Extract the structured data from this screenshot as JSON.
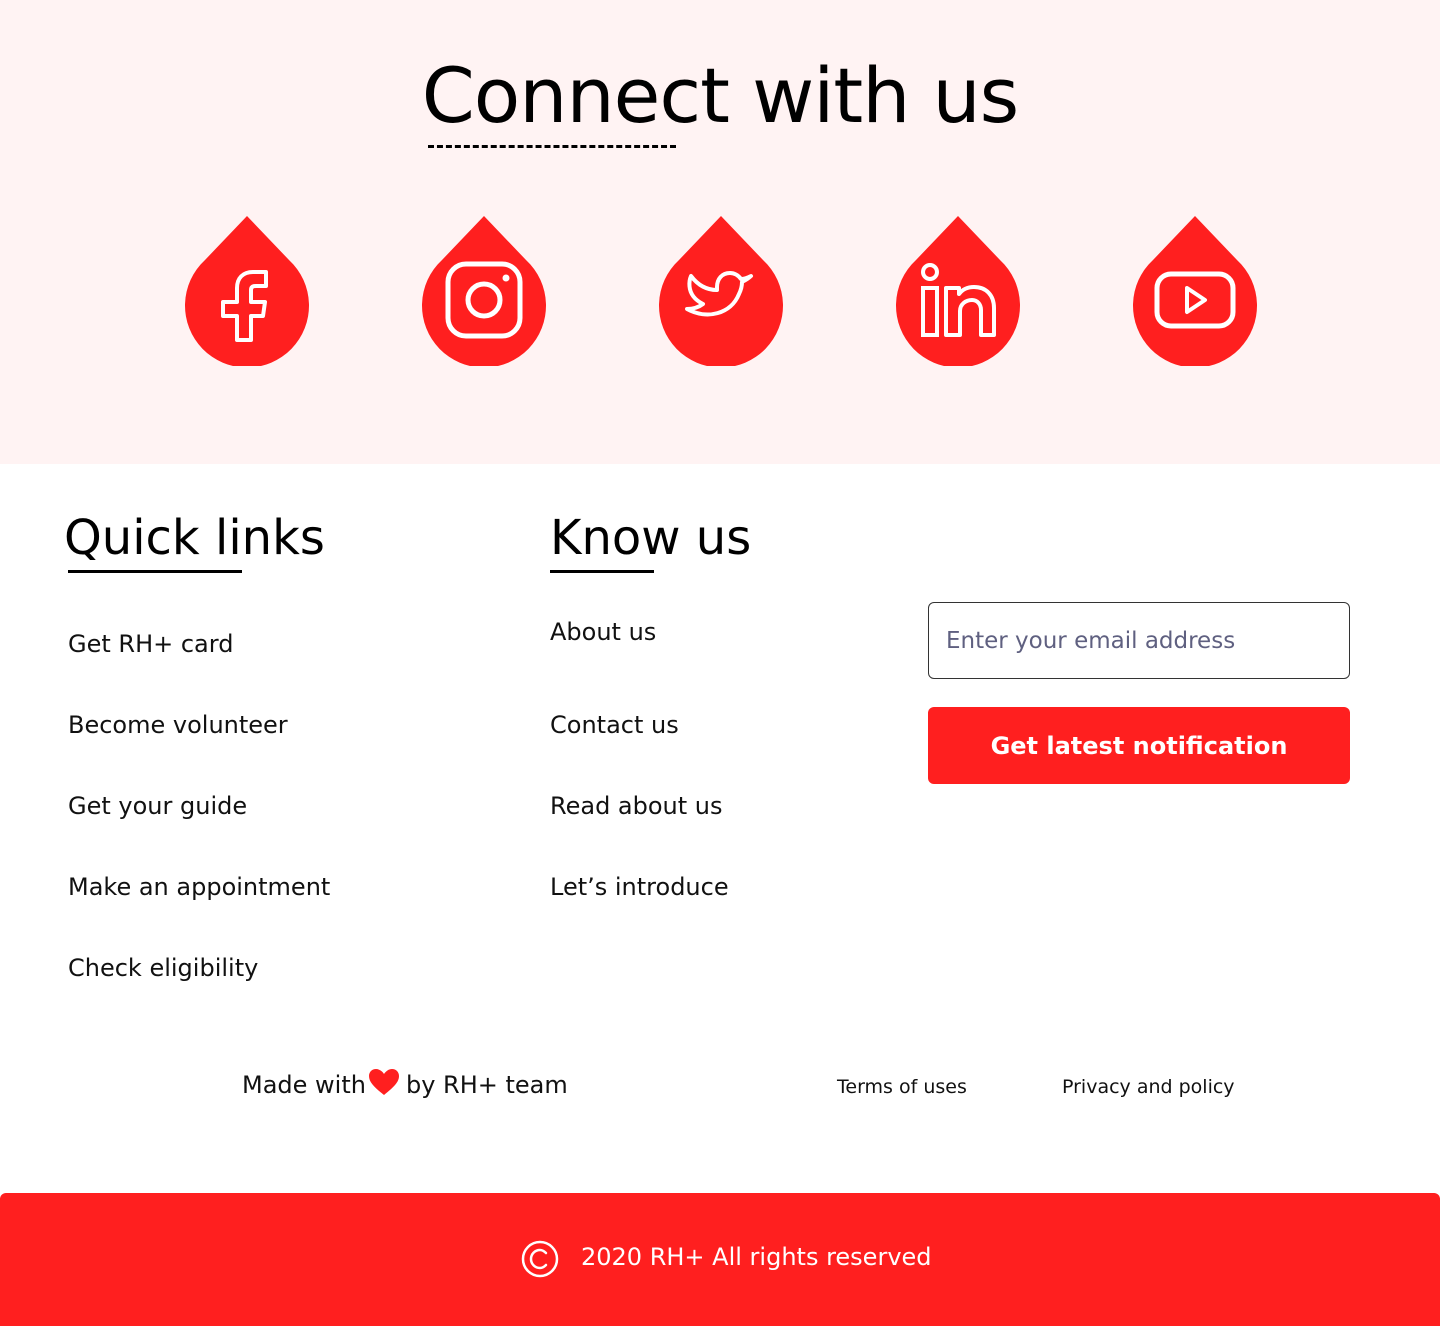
{
  "colors": {
    "accent": "#ff1f1f",
    "connect_background": "#fff3f3",
    "text": "#111111",
    "background": "#ffffff"
  },
  "connect": {
    "title": "Connect with us",
    "social": [
      {
        "name": "Facebook",
        "icon": "facebook-icon"
      },
      {
        "name": "Instagram",
        "icon": "instagram-icon"
      },
      {
        "name": "Twitter",
        "icon": "twitter-icon"
      },
      {
        "name": "LinkedIn",
        "icon": "linkedin-icon"
      },
      {
        "name": "YouTube",
        "icon": "youtube-icon"
      }
    ]
  },
  "quick_links": {
    "title": "Quick links",
    "items": [
      "Get RH+ card",
      "Become volunteer",
      "Get your guide",
      "Make an appointment",
      "Check eligibility"
    ]
  },
  "know_us": {
    "title": "Know us",
    "items": [
      "About us",
      "Contact us",
      "Read about us",
      "Let’s introduce"
    ]
  },
  "newsletter": {
    "email_placeholder": "Enter your email address",
    "email_value": "",
    "button_label": "Get latest notification"
  },
  "footer": {
    "made_with_prefix": "Made with",
    "heart_icon": "heart-icon",
    "made_with_suffix": "by RH+ team",
    "terms": "Terms of uses",
    "privacy": "Privacy and policy",
    "copyright_icon": "copyright-icon",
    "copyright_text": "2020 RH+ All rights reserved"
  }
}
